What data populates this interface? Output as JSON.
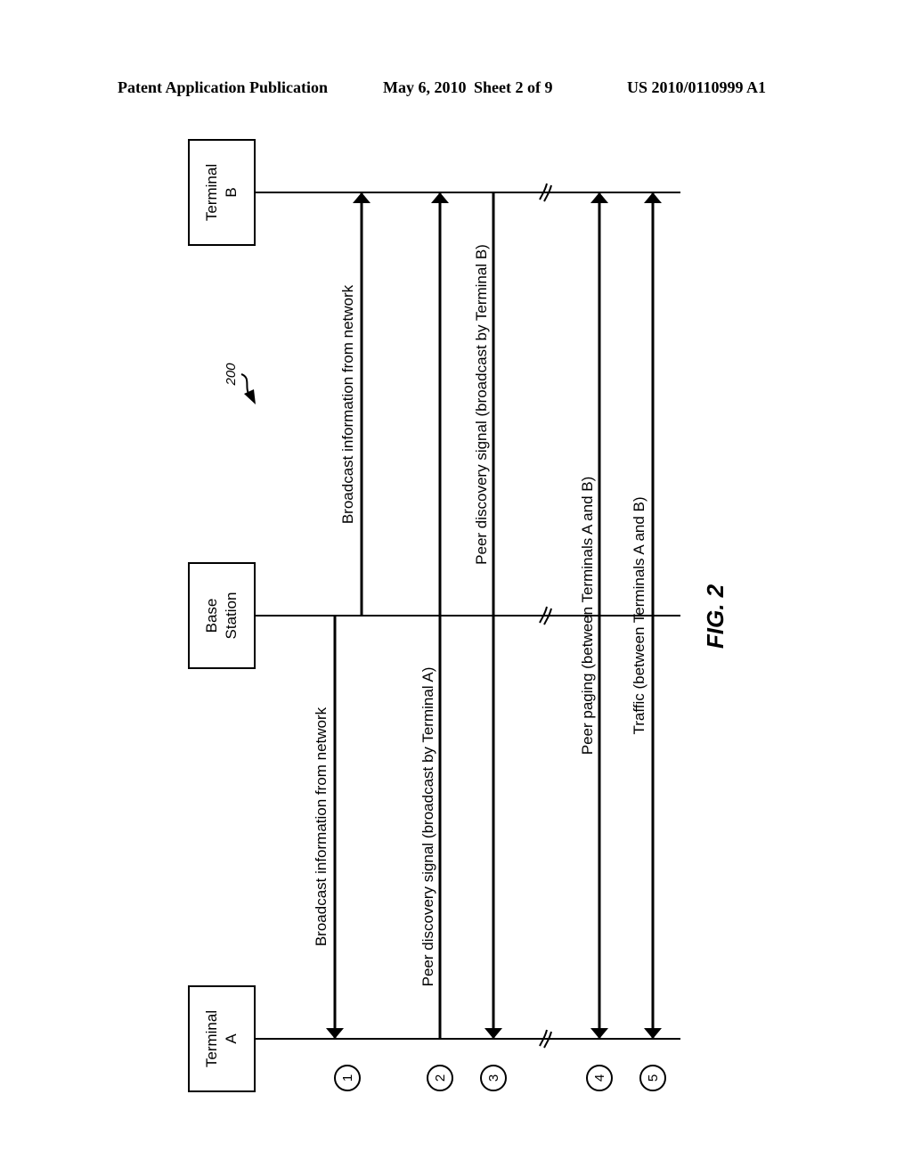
{
  "header": {
    "publication": "Patent Application Publication",
    "date": "May 6, 2010",
    "sheet": "Sheet 2 of 9",
    "number": "US 2010/0110999 A1"
  },
  "figure": {
    "label": "FIG. 2",
    "reference": "200"
  },
  "entities": [
    {
      "id": "terminal_b",
      "line1": "Terminal",
      "line2": "B"
    },
    {
      "id": "base_station",
      "line1": "Base",
      "line2": "Station"
    },
    {
      "id": "terminal_a",
      "line1": "Terminal",
      "line2": "A"
    }
  ],
  "messages": [
    {
      "step": "1",
      "label": "Broadcast information from network",
      "from": "base_station",
      "to": "terminal_a"
    },
    {
      "step": "1",
      "label": "Broadcast information from network",
      "from": "base_station",
      "to": "terminal_b"
    },
    {
      "step": "2",
      "label": "Peer discovery signal (broadcast by Terminal A)",
      "from": "terminal_a",
      "to": "terminal_b"
    },
    {
      "step": "3",
      "label": "Peer discovery signal (broadcast by Terminal B)",
      "from": "terminal_b",
      "to": "terminal_a"
    },
    {
      "step": "4",
      "label": "Peer paging (between Terminals A and B)",
      "from": "terminal_a",
      "to": "terminal_b",
      "bidirectional": true
    },
    {
      "step": "5",
      "label": "Traffic (between Terminals A and B)",
      "from": "terminal_a",
      "to": "terminal_b",
      "bidirectional": true
    }
  ],
  "step_markers": [
    "1",
    "2",
    "3",
    "4",
    "5"
  ]
}
